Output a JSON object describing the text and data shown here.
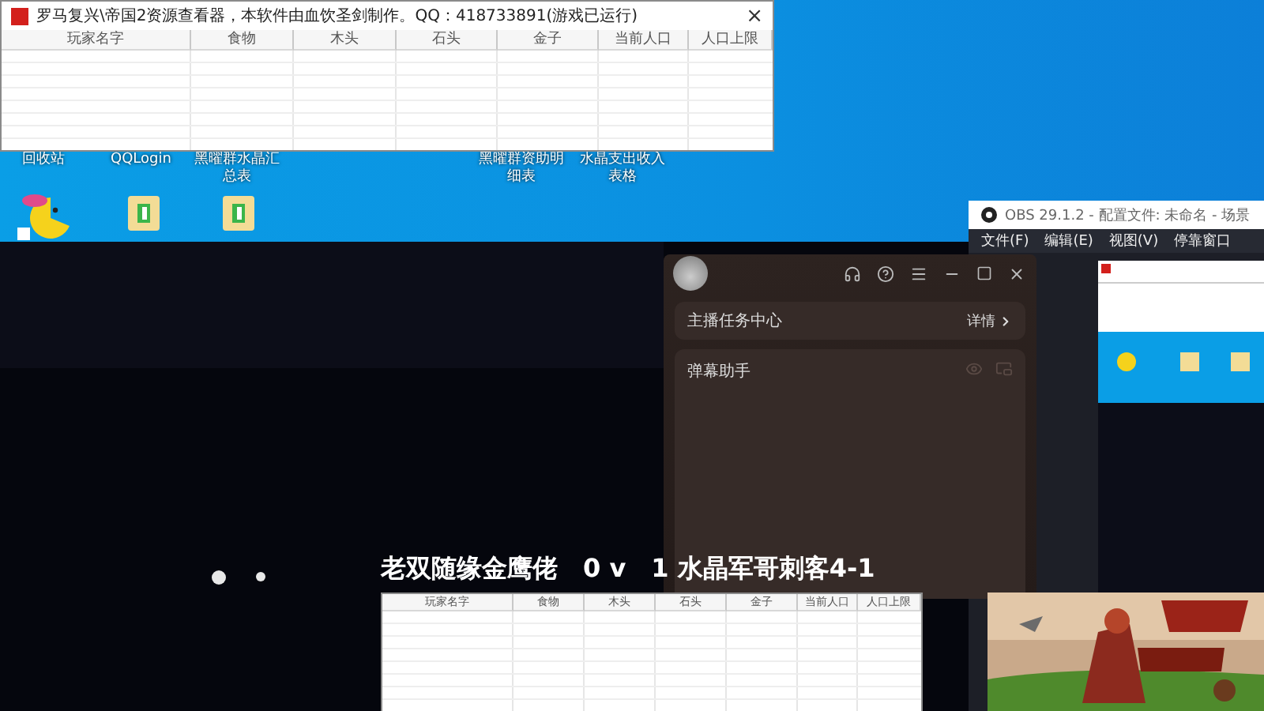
{
  "desktop": {
    "icon_labels": [
      {
        "label": "回收站"
      },
      {
        "label": "QQLogin"
      },
      {
        "label": "黑曜群水晶汇总表"
      },
      {
        "label": "黑曜群资助明细表"
      },
      {
        "label": "水晶支出收入表格"
      }
    ]
  },
  "resource_viewer": {
    "title": "罗马复兴\\帝国2资源查看器，本软件由血饮圣剑制作。QQ：418733891(游戏已运行)",
    "close": "×",
    "columns": [
      "玩家名字",
      "食物",
      "木头",
      "石头",
      "金子",
      "当前人口",
      "人口上限"
    ]
  },
  "live_assistant": {
    "task_center": {
      "title": "主播任务中心",
      "link": "详情"
    },
    "danmaku_panel": {
      "title": "弹幕助手"
    }
  },
  "obs": {
    "title": "OBS 29.1.2 - 配置文件: 未命名 - 场景",
    "menu": [
      "文件(F)",
      "编辑(E)",
      "视图(V)",
      "停靠窗口"
    ]
  },
  "overlay": {
    "score": "老双随缘金鹰佬　0 v　1 水晶军哥刺客4-1",
    "resource_table": {
      "columns": [
        "玩家名字",
        "食物",
        "木头",
        "石头",
        "金子",
        "当前人口",
        "人口上限"
      ]
    }
  }
}
